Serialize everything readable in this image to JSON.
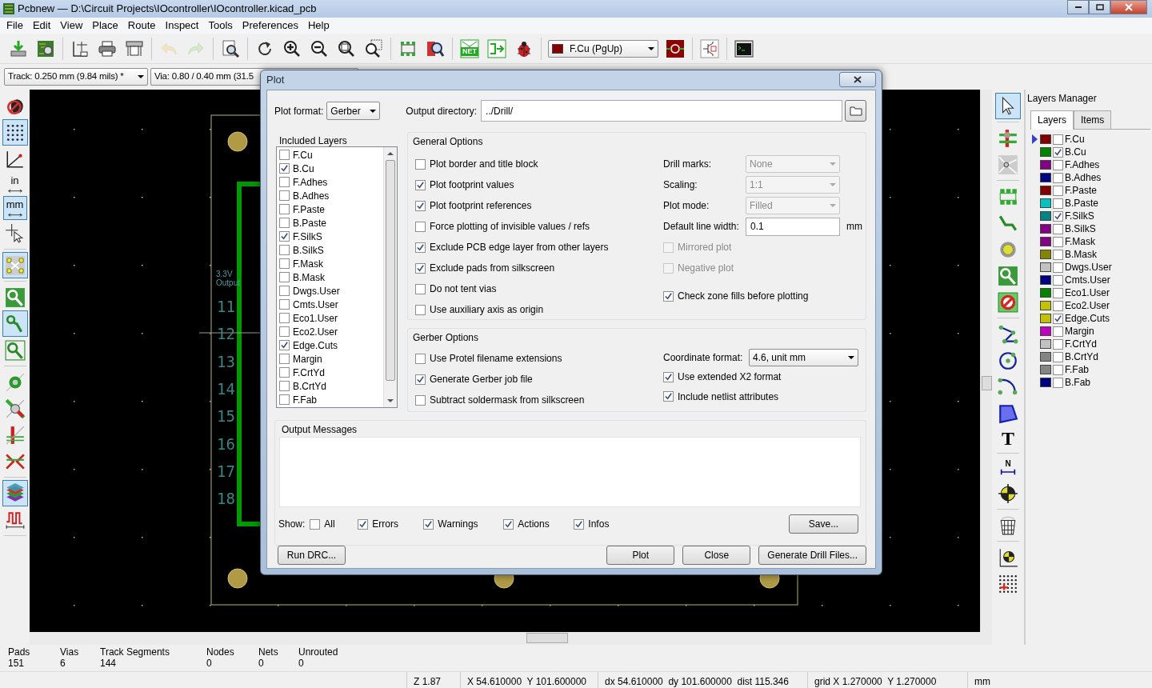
{
  "window": {
    "title": "Pcbnew — D:\\Circuit Projects\\IOcontroller\\IOcontroller.kicad_pcb"
  },
  "menu": [
    "File",
    "Edit",
    "View",
    "Place",
    "Route",
    "Inspect",
    "Tools",
    "Preferences",
    "Help"
  ],
  "toolbar": {
    "items": [
      {
        "disabled": false
      },
      {
        "disabled": false
      },
      {
        "disabled": false
      },
      {
        "disabled": false
      },
      {
        "disabled": false
      },
      {
        "disabled": true
      },
      {
        "disabled": true
      },
      {
        "disabled": false
      },
      {
        "disabled": false
      },
      {
        "disabled": false
      },
      {
        "disabled": false
      },
      {
        "disabled": false
      },
      {
        "disabled": false
      },
      {
        "disabled": false
      },
      {
        "disabled": false
      },
      {
        "disabled": false,
        "label": "NET"
      },
      {
        "disabled": false
      },
      {
        "disabled": false
      },
      {
        "disabled": false
      },
      {
        "disabled": false
      },
      {
        "disabled": false
      }
    ],
    "layer_select": {
      "value": "F.Cu (PgUp)",
      "color": "#840000"
    }
  },
  "track_select": {
    "value": "Track: 0.250 mm (9.84 mils) *"
  },
  "via_select": {
    "value": "Via: 0.80 / 0.40 mm (31.5"
  },
  "left_toolbar": [
    {
      "pressed": false
    },
    {
      "pressed": true
    },
    {
      "pressed": false
    },
    {
      "pressed": false,
      "label": "in"
    },
    {
      "pressed": true,
      "label": "mm"
    },
    {
      "pressed": false
    },
    {
      "pressed": true
    },
    {
      "pressed": false
    },
    {
      "pressed": true
    },
    {
      "pressed": false
    },
    {
      "pressed": false
    },
    {
      "pressed": false
    },
    {
      "pressed": false
    },
    {
      "pressed": false
    },
    {
      "pressed": true
    },
    {
      "pressed": false
    }
  ],
  "canvas": {
    "silk_labels": [
      "3.3V",
      "Output"
    ],
    "pin_numbers": [
      "11",
      "12",
      "13",
      "14",
      "15",
      "16",
      "17",
      "18"
    ]
  },
  "right_toolbar": [
    {
      "pressed": true
    },
    {
      "pressed": false
    },
    {
      "pressed": false
    },
    {
      "pressed": false
    },
    {
      "pressed": false
    },
    {
      "pressed": false
    },
    {
      "pressed": false
    },
    {
      "pressed": false
    },
    {
      "pressed": false
    },
    {
      "pressed": false
    },
    {
      "pressed": false
    },
    {
      "pressed": false
    },
    {
      "pressed": false,
      "label": "T"
    },
    {
      "pressed": false,
      "label": "N"
    },
    {
      "pressed": false
    },
    {
      "pressed": false
    },
    {
      "pressed": false
    },
    {
      "pressed": false
    }
  ],
  "layers_manager": {
    "title": "Layers Manager",
    "tabs": [
      {
        "label": "Layers",
        "selected": true
      },
      {
        "label": "Items",
        "selected": false
      }
    ],
    "layers": [
      {
        "name": "F.Cu",
        "color": "#840000",
        "checked": false,
        "selected": true
      },
      {
        "name": "B.Cu",
        "color": "#008400",
        "checked": true,
        "selected": false
      },
      {
        "name": "F.Adhes",
        "color": "#840084",
        "checked": false,
        "selected": false
      },
      {
        "name": "B.Adhes",
        "color": "#000084",
        "checked": false,
        "selected": false
      },
      {
        "name": "F.Paste",
        "color": "#840000",
        "checked": false,
        "selected": false
      },
      {
        "name": "B.Paste",
        "color": "#00c2c2",
        "checked": false,
        "selected": false
      },
      {
        "name": "F.SilkS",
        "color": "#008484",
        "checked": true,
        "selected": false
      },
      {
        "name": "B.SilkS",
        "color": "#840084",
        "checked": false,
        "selected": false
      },
      {
        "name": "F.Mask",
        "color": "#840084",
        "checked": false,
        "selected": false
      },
      {
        "name": "B.Mask",
        "color": "#848400",
        "checked": false,
        "selected": false
      },
      {
        "name": "Dwgs.User",
        "color": "#c2c2c2",
        "checked": false,
        "selected": false
      },
      {
        "name": "Cmts.User",
        "color": "#000084",
        "checked": false,
        "selected": false
      },
      {
        "name": "Eco1.User",
        "color": "#008400",
        "checked": false,
        "selected": false
      },
      {
        "name": "Eco2.User",
        "color": "#c2c200",
        "checked": false,
        "selected": false
      },
      {
        "name": "Edge.Cuts",
        "color": "#c2c200",
        "checked": true,
        "selected": false
      },
      {
        "name": "Margin",
        "color": "#c200c2",
        "checked": false,
        "selected": false
      },
      {
        "name": "F.CrtYd",
        "color": "#c2c2c2",
        "checked": false,
        "selected": false
      },
      {
        "name": "B.CrtYd",
        "color": "#848484",
        "checked": false,
        "selected": false
      },
      {
        "name": "F.Fab",
        "color": "#848484",
        "checked": false,
        "selected": false
      },
      {
        "name": "B.Fab",
        "color": "#000084",
        "checked": false,
        "selected": false
      }
    ]
  },
  "stats": [
    {
      "label": "Pads",
      "value": "151"
    },
    {
      "label": "Vias",
      "value": "6"
    },
    {
      "label": "Track Segments",
      "value": "144"
    },
    {
      "label": "Nodes",
      "value": "0"
    },
    {
      "label": "Nets",
      "value": "0"
    },
    {
      "label": "Unrouted",
      "value": "0"
    }
  ],
  "status_bar": [
    "Z 1.87",
    "X 54.610000  Y 101.600000",
    "dx 54.610000  dy 101.600000  dist 115.346",
    "grid X 1.270000  Y 1.270000",
    "mm"
  ],
  "dialog": {
    "title": "Plot",
    "plot_format": {
      "label": "Plot format:",
      "value": "Gerber"
    },
    "output_directory": {
      "label": "Output directory:",
      "value": "../Drill/"
    },
    "included_layers": {
      "title": "Included Layers",
      "layers": [
        {
          "name": "F.Cu",
          "checked": false
        },
        {
          "name": "B.Cu",
          "checked": true
        },
        {
          "name": "F.Adhes",
          "checked": false
        },
        {
          "name": "B.Adhes",
          "checked": false
        },
        {
          "name": "F.Paste",
          "checked": false
        },
        {
          "name": "B.Paste",
          "checked": false
        },
        {
          "name": "F.SilkS",
          "checked": true
        },
        {
          "name": "B.SilkS",
          "checked": false
        },
        {
          "name": "F.Mask",
          "checked": false
        },
        {
          "name": "B.Mask",
          "checked": false
        },
        {
          "name": "Dwgs.User",
          "checked": false
        },
        {
          "name": "Cmts.User",
          "checked": false
        },
        {
          "name": "Eco1.User",
          "checked": false
        },
        {
          "name": "Eco2.User",
          "checked": false
        },
        {
          "name": "Edge.Cuts",
          "checked": true
        },
        {
          "name": "Margin",
          "checked": false
        },
        {
          "name": "F.CrtYd",
          "checked": false
        },
        {
          "name": "B.CrtYd",
          "checked": false
        },
        {
          "name": "F.Fab",
          "checked": false
        }
      ]
    },
    "general_options": {
      "title": "General Options",
      "left": [
        {
          "label": "Plot border and title block",
          "checked": false
        },
        {
          "label": "Plot footprint values",
          "checked": true
        },
        {
          "label": "Plot footprint references",
          "checked": true
        },
        {
          "label": "Force plotting of invisible values / refs",
          "checked": false
        },
        {
          "label": "Exclude PCB edge layer from other layers",
          "checked": true
        },
        {
          "label": "Exclude pads from silkscreen",
          "checked": true
        },
        {
          "label": "Do not tent vias",
          "checked": false
        },
        {
          "label": "Use auxiliary axis as origin",
          "checked": false
        }
      ],
      "right": [
        {
          "kind": "select",
          "label": "Drill marks:",
          "value": "None",
          "disabled": true
        },
        {
          "kind": "select",
          "label": "Scaling:",
          "value": "1:1",
          "disabled": true
        },
        {
          "kind": "select",
          "label": "Plot mode:",
          "value": "Filled",
          "disabled": true
        },
        {
          "kind": "input",
          "label": "Default line width:",
          "value": "0.1",
          "unit": "mm",
          "disabled": false
        },
        {
          "kind": "checkbox",
          "label": "Mirrored plot",
          "checked": false,
          "disabled": true
        },
        {
          "kind": "checkbox",
          "label": "Negative plot",
          "checked": false,
          "disabled": true
        },
        {
          "kind": "checkbox",
          "label": "Check zone fills before plotting",
          "checked": true,
          "disabled": false
        }
      ]
    },
    "gerber_options": {
      "title": "Gerber Options",
      "left": [
        {
          "label": "Use Protel filename extensions",
          "checked": false
        },
        {
          "label": "Generate Gerber job file",
          "checked": true
        },
        {
          "label": "Subtract soldermask from silkscreen",
          "checked": false
        }
      ],
      "right": [
        {
          "kind": "select",
          "label": "Coordinate format:",
          "value": "4.6, unit mm",
          "disabled": false
        },
        {
          "kind": "checkbox",
          "label": "Use extended X2 format",
          "checked": true,
          "disabled": false
        },
        {
          "kind": "checkbox",
          "label": "Include netlist attributes",
          "checked": true,
          "disabled": false
        }
      ]
    },
    "output_messages": {
      "title": "Output Messages",
      "show_label": "Show:",
      "filters": [
        {
          "label": "All",
          "checked": false
        },
        {
          "label": "Errors",
          "checked": true
        },
        {
          "label": "Warnings",
          "checked": true
        },
        {
          "label": "Actions",
          "checked": true
        },
        {
          "label": "Infos",
          "checked": true
        }
      ],
      "save_button": "Save..."
    },
    "buttons": [
      {
        "label": "Run DRC..."
      },
      {
        "label": "Plot"
      },
      {
        "label": "Close"
      },
      {
        "label": "Generate Drill Files..."
      }
    ]
  }
}
